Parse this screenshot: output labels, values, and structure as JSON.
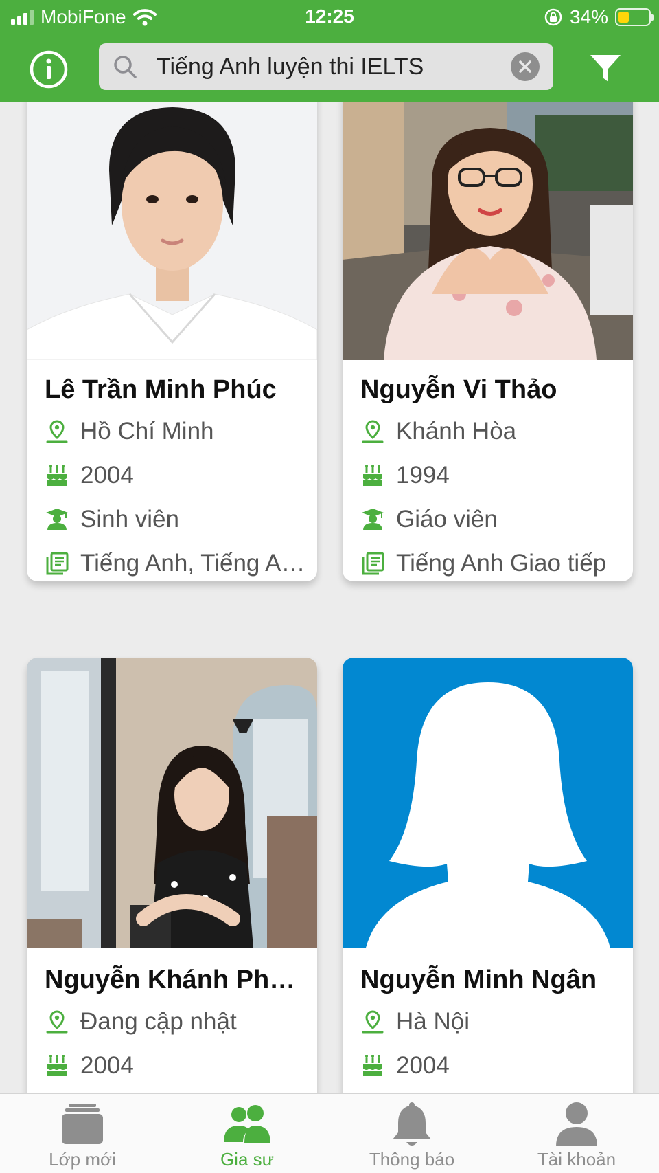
{
  "status_bar": {
    "carrier": "MobiFone",
    "time": "12:25",
    "battery_percent": "34%",
    "battery_level": 0.34,
    "icons": [
      "signal-icon",
      "wifi-icon",
      "orientation-lock-icon",
      "battery-icon"
    ]
  },
  "search": {
    "query": "Tiếng Anh luyện thi IELTS",
    "icons": [
      "info-icon",
      "search-icon",
      "clear-icon",
      "filter-icon"
    ]
  },
  "tutors": [
    {
      "name": "Lê Trần Minh Phúc",
      "location": "Hồ Chí Minh",
      "birth_year": "2004",
      "occupation": "Sinh viên",
      "subjects": "Tiếng Anh, Tiếng Anh luyện thi IELTS"
    },
    {
      "name": "Nguyễn Vi Thảo",
      "location": "Khánh Hòa",
      "birth_year": "1994",
      "occupation": "Giáo viên",
      "subjects": "Tiếng Anh Giao tiếp"
    },
    {
      "name": "Nguyễn Khánh Phương",
      "location": "Đang cập nhật",
      "birth_year": "2004"
    },
    {
      "name": "Nguyễn Minh Ngân",
      "location": "Hà Nội",
      "birth_year": "2004"
    }
  ],
  "tabs": [
    {
      "label": "Lớp mới",
      "icon": "classes-icon",
      "active": false
    },
    {
      "label": "Gia sư",
      "icon": "tutors-icon",
      "active": true
    },
    {
      "label": "Thông báo",
      "icon": "bell-icon",
      "active": false
    },
    {
      "label": "Tài khoản",
      "icon": "user-icon",
      "active": false
    }
  ],
  "colors": {
    "brand_green": "#4caf3f",
    "inactive_gray": "#8e8e8e",
    "avatar_blue": "#0288d1",
    "battery_yellow": "#ffd60a"
  }
}
